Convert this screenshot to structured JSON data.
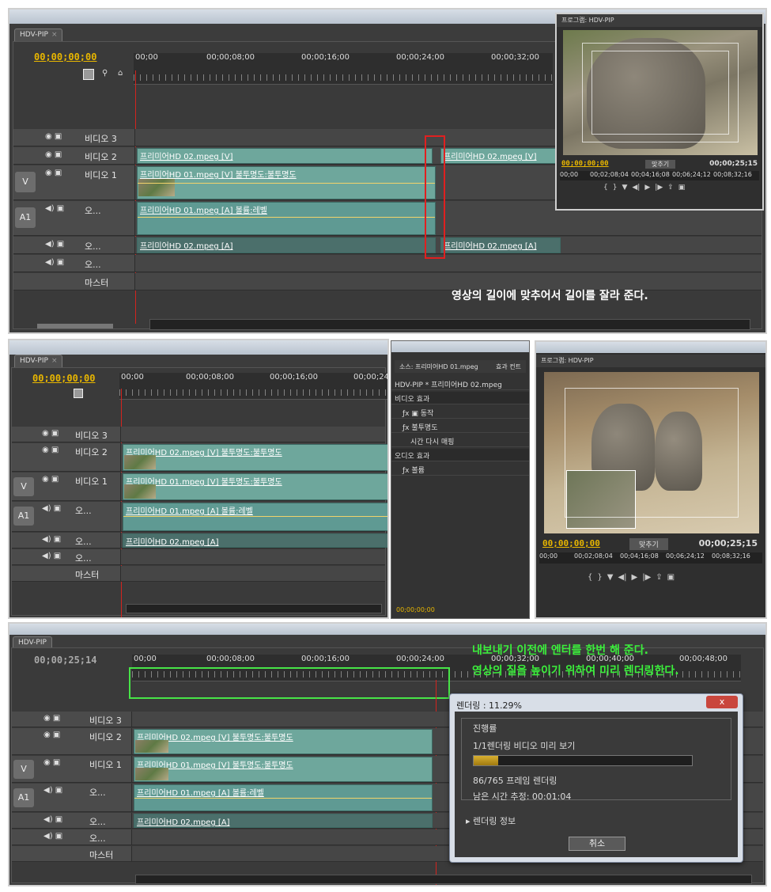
{
  "panel1": {
    "tab": "HDV-PIP",
    "timecode": "00;00;00;00",
    "ruler": [
      "00;00",
      "00;00;08;00",
      "00;00;16;00",
      "00;00;24;00",
      "00;00;32;00"
    ],
    "tracks": {
      "v3": "비디오 3",
      "v2": "비디오 2",
      "v1": "비디오 1",
      "a1": "오...",
      "a2": "오...",
      "a3": "오...",
      "master": "마스터",
      "v_label": "V",
      "a1_label": "A1"
    },
    "clips": {
      "v2_clip": "프리미어HD 02.mpeg [V]",
      "v2_clip_right": "프리미어HD 02.mpeg [V]",
      "v1_clip": "프리미어HD 01.mpeg [V] 불투명도:불투명도",
      "a1_clip": "프리미어HD 01.mpeg [A] 볼륨:레벨",
      "a2_clip": "프리미어HD 02.mpeg [A]",
      "a2_clip_right": "프리미어HD 02.mpeg [A]"
    },
    "caption": "영상의 길이에 맞추어서 길이를 잘라 준다.",
    "monitor": {
      "title": "프로그램: HDV-PIP",
      "tc_in": "00;00;00;00",
      "fit": "맞추기",
      "tc_dur": "00;00;25;15",
      "ruler": [
        "00;00",
        "00;02;08;04",
        "00;04;16;08",
        "00;06;24;12",
        "00;08;32;16",
        "00;"
      ]
    }
  },
  "panel2": {
    "tab": "HDV-PIP",
    "timecode": "00;00;00;00",
    "ruler": [
      "00;00",
      "00;00;08;00",
      "00;00;16;00",
      "00;00;24;00"
    ],
    "tracks": {
      "v3": "비디오 3",
      "v2": "비디오 2",
      "v1": "비디오 1",
      "a1": "오...",
      "a2": "오...",
      "a3": "오...",
      "master": "마스터",
      "v_label": "V",
      "a1_label": "A1"
    },
    "clips": {
      "v2_clip": "프리미어HD 02.mpeg [V] 불투명도:불투명도",
      "v1_clip": "프리미어HD 01.mpeg [V] 불투명도:불투명도",
      "a1_clip": "프리미어HD 01.mpeg [A] 볼륨:레벨",
      "a2_clip": "프리미어HD 02.mpeg [A]"
    },
    "effects": {
      "tab_source": "소스: 프리미어HD 01.mpeg",
      "tab_effects": "효과 컨트",
      "path": "HDV-PIP * 프리미어HD 02.mpeg",
      "video_fx": "비디오 효과",
      "motion": "동작",
      "opacity": "불투명도",
      "time_remap": "시간 다시 매핑",
      "audio_fx": "오디오 효과",
      "volume": "볼륨",
      "tc": "00;00;00;00",
      "tc_right": "00;0"
    },
    "monitor": {
      "title": "프로그램: HDV-PIP",
      "tc_in": "00;00;00;00",
      "fit": "맞추기",
      "tc_dur": "00;00;25;15",
      "ruler": [
        "00;00",
        "00;02;08;04",
        "00;04;16;08",
        "00;06;24;12",
        "00;08;32;16",
        "00;"
      ]
    }
  },
  "panel3": {
    "tab": "HDV-PIP",
    "timecode": "00;00;25;14",
    "ruler": [
      "00;00",
      "00;00;08;00",
      "00;00;16;00",
      "00;00;24;00",
      "00;00;32;00",
      "00;00;40;00",
      "00;00;48;00"
    ],
    "tracks": {
      "v3": "비디오 3",
      "v2": "비디오 2",
      "v1": "비디오 1",
      "a1": "오...",
      "a2": "오...",
      "a3": "오...",
      "master": "마스터",
      "v_label": "V",
      "a1_label": "A1"
    },
    "clips": {
      "v2_clip": "프리미어HD 02.mpeg [V] 불투명도:불투명도",
      "v1_clip": "프리미어HD 01.mpeg [V] 불투명도:불투명도",
      "a1_clip": "프리미어HD 01.mpeg [A] 볼륨:레벨",
      "a2_clip": "프리미어HD 02.mpeg [A]"
    },
    "caption_1": "내보내기 이전에 엔터를 한번 해 준다.",
    "caption_2": "영상의 질을 높이기 위하여 미리 렌더링한다.",
    "dialog": {
      "title": "렌더링 : 11.29%",
      "close": "x",
      "group": "진행률",
      "step": "1/1렌더링 비디오 미리 보기",
      "progress": 0.113,
      "frames": "86/765 프레임 렌더링",
      "remaining": "남은 시간 추정: 00:01:04",
      "info": "렌더링 정보",
      "cancel": "취소"
    }
  },
  "colors": {
    "timecode": "#e8b600",
    "clip": "#6ea79c",
    "playhead": "#d2241f",
    "highlight_red": "#e02020",
    "highlight_green": "#47e447"
  }
}
